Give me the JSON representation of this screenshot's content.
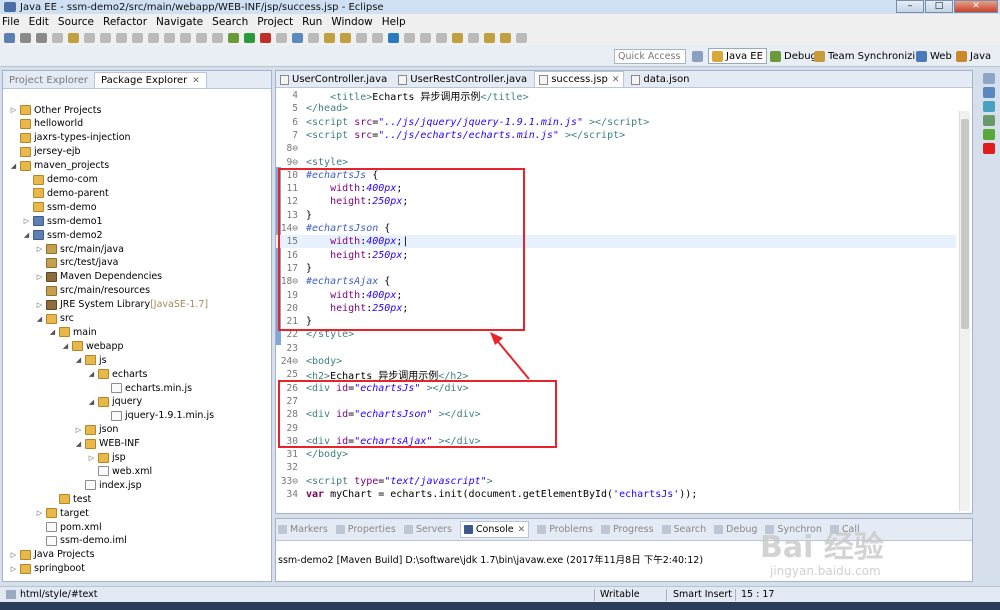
{
  "window": {
    "title": "Java EE - ssm-demo2/src/main/webapp/WEB-INF/jsp/success.jsp - Eclipse"
  },
  "menu": [
    "File",
    "Edit",
    "Source",
    "Refactor",
    "Navigate",
    "Search",
    "Project",
    "Run",
    "Window",
    "Help"
  ],
  "quick_access": {
    "placeholder": "Quick Access"
  },
  "perspectives": [
    "Java EE",
    "Debug",
    "Team Synchronizing",
    "Web",
    "Java"
  ],
  "left_panel": {
    "tabs": [
      "Project Explorer",
      "Package Explorer"
    ],
    "tree": [
      {
        "label": "Other Projects",
        "indent": 0,
        "icon": "fold",
        "twisty": "▷"
      },
      {
        "label": "helloworld",
        "indent": 0,
        "icon": "fold",
        "twisty": ""
      },
      {
        "label": "jaxrs-types-injection",
        "indent": 0,
        "icon": "fold",
        "twisty": ""
      },
      {
        "label": "jersey-ejb",
        "indent": 0,
        "icon": "fold",
        "twisty": ""
      },
      {
        "label": "maven_projects",
        "indent": 0,
        "icon": "fold",
        "twisty": "◢"
      },
      {
        "label": "demo-com",
        "indent": 1,
        "icon": "fold",
        "twisty": ""
      },
      {
        "label": "demo-parent",
        "indent": 1,
        "icon": "fold",
        "twisty": ""
      },
      {
        "label": "ssm-demo",
        "indent": 1,
        "icon": "fold",
        "twisty": ""
      },
      {
        "label": "ssm-demo1",
        "indent": 1,
        "icon": "proj",
        "twisty": "▷"
      },
      {
        "label": "ssm-demo2",
        "indent": 1,
        "icon": "proj",
        "twisty": "◢"
      },
      {
        "label": "src/main/java",
        "indent": 2,
        "icon": "pkg",
        "twisty": "▷"
      },
      {
        "label": "src/test/java",
        "indent": 2,
        "icon": "pkg",
        "twisty": ""
      },
      {
        "label": "Maven Dependencies",
        "indent": 2,
        "icon": "lib",
        "twisty": "▷"
      },
      {
        "label": "src/main/resources",
        "indent": 2,
        "icon": "pkg",
        "twisty": ""
      },
      {
        "label": "JRE System Library",
        "suffix": "[JavaSE-1.7]",
        "indent": 2,
        "icon": "lib",
        "twisty": "▷"
      },
      {
        "label": "src",
        "indent": 2,
        "icon": "fold",
        "twisty": "◢"
      },
      {
        "label": "main",
        "indent": 3,
        "icon": "fold",
        "twisty": "◢"
      },
      {
        "label": "webapp",
        "indent": 4,
        "icon": "fold",
        "twisty": "◢"
      },
      {
        "label": "js",
        "indent": 5,
        "icon": "fold",
        "twisty": "◢"
      },
      {
        "label": "echarts",
        "indent": 6,
        "icon": "fold",
        "twisty": "◢"
      },
      {
        "label": "echarts.min.js",
        "indent": 7,
        "icon": "file",
        "twisty": ""
      },
      {
        "label": "jquery",
        "indent": 6,
        "icon": "fold",
        "twisty": "◢"
      },
      {
        "label": "jquery-1.9.1.min.js",
        "indent": 7,
        "icon": "file",
        "twisty": ""
      },
      {
        "label": "json",
        "indent": 5,
        "icon": "fold",
        "twisty": "▷"
      },
      {
        "label": "WEB-INF",
        "indent": 5,
        "icon": "fold",
        "twisty": "◢"
      },
      {
        "label": "jsp",
        "indent": 6,
        "icon": "fold",
        "twisty": "▷"
      },
      {
        "label": "web.xml",
        "indent": 6,
        "icon": "file",
        "twisty": ""
      },
      {
        "label": "index.jsp",
        "indent": 5,
        "icon": "file",
        "twisty": ""
      },
      {
        "label": "test",
        "indent": 3,
        "icon": "fold",
        "twisty": ""
      },
      {
        "label": "target",
        "indent": 2,
        "icon": "fold",
        "twisty": "▷"
      },
      {
        "label": "pom.xml",
        "indent": 2,
        "icon": "file",
        "twisty": ""
      },
      {
        "label": "ssm-demo.iml",
        "indent": 2,
        "icon": "file",
        "twisty": ""
      },
      {
        "label": "Java Projects",
        "indent": 0,
        "icon": "fold",
        "twisty": "▷"
      },
      {
        "label": "springboot",
        "indent": 0,
        "icon": "fold",
        "twisty": "▷"
      }
    ]
  },
  "editor": {
    "tabs": [
      "UserController.java",
      "UserRestController.java",
      "success.jsp",
      "data.json"
    ],
    "active_tab": "success.jsp",
    "lines": [
      {
        "n": "4",
        "html": "    <span class='tag'>&lt;title&gt;</span>Echarts 异步调用示例<span class='tag'>&lt;/title&gt;</span>"
      },
      {
        "n": "5",
        "html": "<span class='tag'>&lt;/head&gt;</span>"
      },
      {
        "n": "6",
        "html": "<span class='tag'>&lt;script</span> <span class='attr'>src</span>=<span class='str'>\"../js/jquery/jquery-1.9.1.min.js\"</span> <span class='tag'>&gt;&lt;/script&gt;</span>"
      },
      {
        "n": "7",
        "html": "<span class='tag'>&lt;script</span> <span class='attr'>src</span>=<span class='str'>\"../js/echarts/echarts.min.js\"</span> <span class='tag'>&gt;&lt;/script&gt;</span>"
      },
      {
        "n": "8⊖",
        "html": ""
      },
      {
        "n": "9⊖",
        "html": "<span class='tag'>&lt;style&gt;</span>"
      },
      {
        "n": "10",
        "html": "<span class='sel'>#echartsJs</span> {"
      },
      {
        "n": "11",
        "html": "    <span class='prop'>width</span>:<span class='val'>400px</span>;"
      },
      {
        "n": "12",
        "html": "    <span class='prop'>height</span>:<span class='val'>250px</span>;"
      },
      {
        "n": "13",
        "html": "}"
      },
      {
        "n": "14⊖",
        "html": "<span class='sel'>#echartsJson</span> {"
      },
      {
        "n": "15",
        "html": "    <span class='prop'>width</span>:<span class='val'>400px</span>;|",
        "cur": true
      },
      {
        "n": "16",
        "html": "    <span class='prop'>height</span>:<span class='val'>250px</span>;"
      },
      {
        "n": "17",
        "html": "}"
      },
      {
        "n": "18⊖",
        "html": "<span class='sel'>#echartsAjax</span> {"
      },
      {
        "n": "19",
        "html": "    <span class='prop'>width</span>:<span class='val'>400px</span>;"
      },
      {
        "n": "20",
        "html": "    <span class='prop'>height</span>:<span class='val'>250px</span>;"
      },
      {
        "n": "21",
        "html": "}"
      },
      {
        "n": "22",
        "html": "<span class='tag'>&lt;/style&gt;</span>"
      },
      {
        "n": "23",
        "html": ""
      },
      {
        "n": "24⊖",
        "html": "<span class='tag'>&lt;body&gt;</span>"
      },
      {
        "n": "25",
        "html": "<span class='tag'>&lt;h2&gt;</span>Echarts 异步调用示例<span class='tag'>&lt;/h2&gt;</span>"
      },
      {
        "n": "26",
        "html": "<span class='tag'>&lt;div</span> <span class='attr'>id</span>=<span class='str'>\"echartsJs\"</span> <span class='tag'>&gt;&lt;/div&gt;</span>"
      },
      {
        "n": "27",
        "html": ""
      },
      {
        "n": "28",
        "html": "<span class='tag'>&lt;div</span> <span class='attr'>id</span>=<span class='str'>\"echartsJson\"</span> <span class='tag'>&gt;&lt;/div&gt;</span>"
      },
      {
        "n": "29",
        "html": ""
      },
      {
        "n": "30",
        "html": "<span class='tag'>&lt;div</span> <span class='attr'>id</span>=<span class='str'>\"echartsAjax\"</span> <span class='tag'>&gt;&lt;/div&gt;</span>"
      },
      {
        "n": "31",
        "html": "<span class='tag'>&lt;/body&gt;</span>"
      },
      {
        "n": "32",
        "html": ""
      },
      {
        "n": "33⊖",
        "html": "<span class='tag'>&lt;script</span> <span class='attr'>type</span>=<span class='str'>\"text/javascript\"</span><span class='tag'>&gt;</span>"
      },
      {
        "n": "34",
        "html": "<span class='kw'>var</span> myChart = echarts.init(document.getElementById(<span class='js-str'>'echartsJs'</span>));"
      }
    ]
  },
  "bottom_panel": {
    "tabs": [
      "Markers",
      "Properties",
      "Servers",
      "Console",
      "Problems",
      "Progress",
      "Search",
      "Debug",
      "Synchron",
      "Call"
    ],
    "active_tab": "Console",
    "console_text": "ssm-demo2 [Maven Build] D:\\software\\jdk 1.7\\bin\\javaw.exe (2017年11月8日 下午2:40:12)"
  },
  "status": {
    "path": "html/style/#text",
    "mode": "Writable",
    "insert": "Smart Insert",
    "position": "15 : 17"
  },
  "watermark": {
    "main": "Bai 经验",
    "sub": "jingyan.baidu.com"
  },
  "colors": {
    "red_annotation": "#e8242a",
    "title_bg": "#cfe0f3",
    "panel_border": "#a6b3c7"
  }
}
